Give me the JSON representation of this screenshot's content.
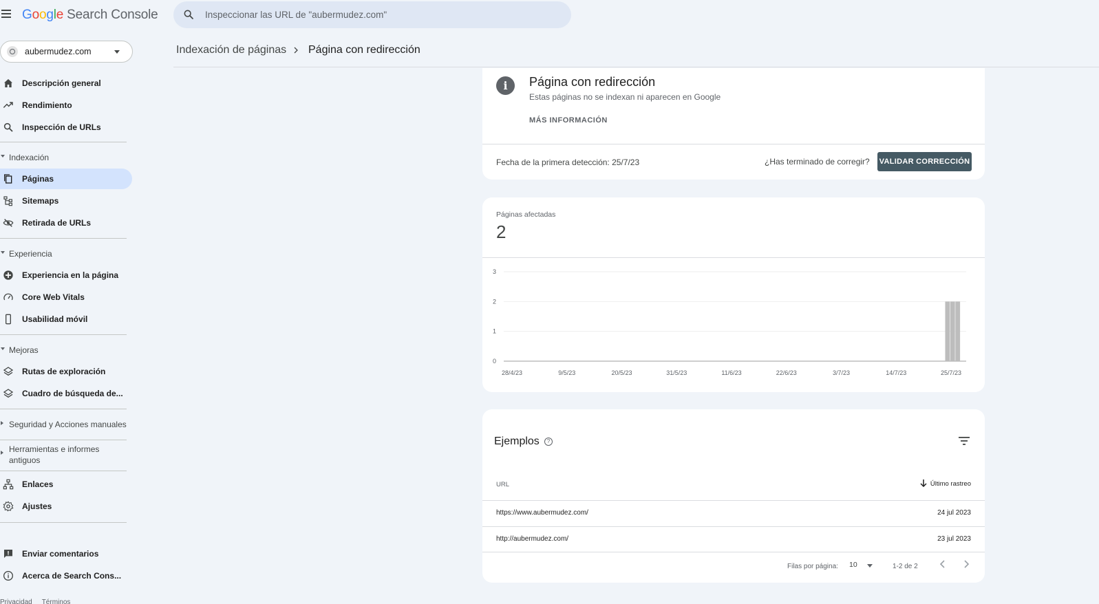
{
  "app": {
    "logo_letters": [
      "G",
      "o",
      "o",
      "g",
      "l",
      "e"
    ],
    "product": "Search Console"
  },
  "search": {
    "placeholder": "Inspeccionar las URL de \"aubermudez.com\""
  },
  "property": {
    "name": "aubermudez.com"
  },
  "sidebar": {
    "top_items": [
      {
        "label": "Descripción general",
        "icon": "home-icon"
      },
      {
        "label": "Rendimiento",
        "icon": "trending-up-icon"
      },
      {
        "label": "Inspección de URLs",
        "icon": "search-icon"
      }
    ],
    "indexing": {
      "label": "Indexación",
      "items": [
        {
          "label": "Páginas",
          "icon": "pages-icon",
          "active": true
        },
        {
          "label": "Sitemaps",
          "icon": "sitemap-icon"
        },
        {
          "label": "Retirada de URLs",
          "icon": "eye-off-icon"
        }
      ]
    },
    "experience": {
      "label": "Experiencia",
      "items": [
        {
          "label": "Experiencia en la página",
          "icon": "plus-circle-icon"
        },
        {
          "label": "Core Web Vitals",
          "icon": "gauge-icon"
        },
        {
          "label": "Usabilidad móvil",
          "icon": "phone-icon"
        }
      ]
    },
    "enhancements": {
      "label": "Mejoras",
      "items": [
        {
          "label": "Rutas de exploración",
          "icon": "layers-icon"
        },
        {
          "label": "Cuadro de búsqueda de...",
          "icon": "layers-icon"
        }
      ]
    },
    "security": {
      "label": "Seguridad y Acciones manuales"
    },
    "legacy": {
      "label": "Herramientas e informes antiguos"
    },
    "bottom_items": [
      {
        "label": "Enlaces",
        "icon": "links-icon"
      },
      {
        "label": "Ajustes",
        "icon": "gear-icon"
      }
    ],
    "footer_items": [
      {
        "label": "Enviar comentarios",
        "icon": "feedback-icon"
      },
      {
        "label": "Acerca de Search Cons...",
        "icon": "info-icon"
      }
    ],
    "footer_links": [
      "Privacidad",
      "Términos"
    ]
  },
  "breadcrumb": {
    "parent": "Indexación de páginas",
    "current": "Página con redirección"
  },
  "issue": {
    "title": "Página con redirección",
    "subtitle": "Estas páginas no se indexan ni aparecen en Google",
    "more_info": "MÁS INFORMACIÓN",
    "first_detected": "Fecha de la primera detección: 25/7/23",
    "fix_question": "¿Has terminado de corregir?",
    "validate_label": "VALIDAR CORRECCIÓN"
  },
  "affected": {
    "label": "Páginas afectadas",
    "value": "2"
  },
  "chart_data": {
    "type": "bar",
    "ylim": [
      0,
      3
    ],
    "yticks": [
      "0",
      "1",
      "2",
      "3"
    ],
    "xtick_labels": [
      "28/4/23",
      "9/5/23",
      "20/5/23",
      "31/5/23",
      "11/6/23",
      "22/6/23",
      "3/7/23",
      "14/7/23",
      "25/7/23"
    ],
    "x_range_days": [
      0,
      89
    ],
    "bars": [
      {
        "day": 87,
        "value": 2
      },
      {
        "day": 88,
        "value": 2
      },
      {
        "day": 89,
        "value": 2
      }
    ],
    "bar_color": "#bdbdbd",
    "grid": true
  },
  "examples": {
    "title": "Ejemplos",
    "col_url": "URL",
    "col_date": "Último rastreo",
    "rows": [
      {
        "url": "https://www.aubermudez.com/",
        "date": "24 jul 2023"
      },
      {
        "url": "http://aubermudez.com/",
        "date": "23 jul 2023"
      }
    ],
    "rows_per_page_label": "Filas por página:",
    "rows_per_page": "10",
    "range": "1-2 de 2"
  }
}
